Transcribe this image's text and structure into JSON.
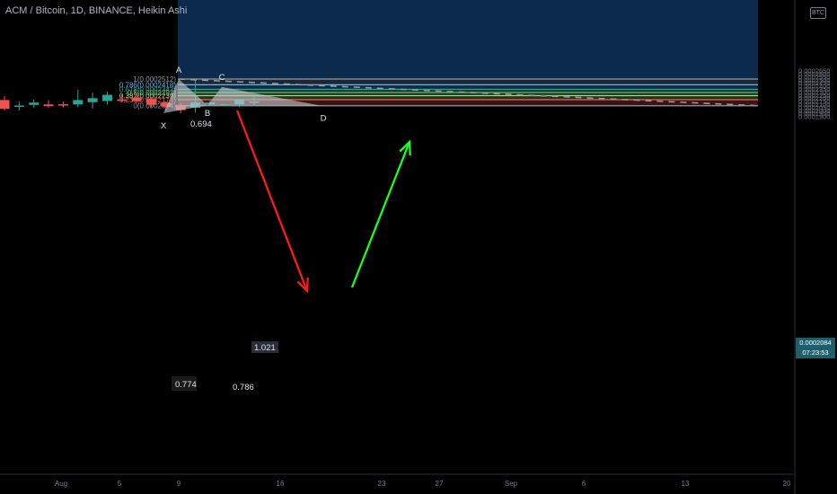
{
  "header": {
    "title": "ACM / Bitcoin, 1D, BINANCE, Heikin Ashi",
    "currency_badge": "BTC"
  },
  "price_tag": {
    "price": "0.0002084",
    "countdown": "07:23:53",
    "color": "#1e5f6e"
  },
  "colors": {
    "background": "#000000",
    "up_candle": "#26a69a",
    "down_candle": "#ef5350",
    "pattern_fill": "#c8ccd2",
    "down_arrow": "#ff1a1a",
    "up_arrow": "#1aff1a",
    "trend_line": "#9598a1"
  },
  "chart_data": {
    "type": "candlestick",
    "y_axis": {
      "ticks": [
        "0.0002650",
        "0.0002600",
        "0.0002550",
        "0.0002500",
        "0.0002450",
        "0.0002400",
        "0.0002350",
        "0.0002300",
        "0.0002250",
        "0.0002200",
        "0.0002150",
        "0.0002100",
        "0.0002050",
        "0.0002000",
        "0.0001950",
        "0.0001900"
      ],
      "ylim": [
        0.000187,
        0.0002665
      ]
    },
    "x_axis": {
      "ticks": [
        "Aug",
        "5",
        "9",
        "16",
        "23",
        "27",
        "Sep",
        "6",
        "13",
        "20"
      ]
    },
    "candles": [
      {
        "o": 0.0002168,
        "h": 0.0002232,
        "l": 0.0001998,
        "c": 0.0002023
      },
      {
        "o": 0.0002058,
        "h": 0.0002138,
        "l": 0.0001992,
        "c": 0.0002078
      },
      {
        "o": 0.0002088,
        "h": 0.0002175,
        "l": 0.0002038,
        "c": 0.0002126
      },
      {
        "o": 0.0002095,
        "h": 0.0002165,
        "l": 0.0002043,
        "c": 0.0002067
      },
      {
        "o": 0.0002098,
        "h": 0.0002142,
        "l": 0.0002045,
        "c": 0.0002095
      },
      {
        "o": 0.0002095,
        "h": 0.0002338,
        "l": 0.0002047,
        "c": 0.0002168
      },
      {
        "o": 0.0002133,
        "h": 0.0002288,
        "l": 0.0002028,
        "c": 0.0002198
      },
      {
        "o": 0.0002152,
        "h": 0.0002305,
        "l": 0.0002092,
        "c": 0.0002253
      },
      {
        "o": 0.0002177,
        "h": 0.0002262,
        "l": 0.0002142,
        "c": 0.0002172
      },
      {
        "o": 0.0002205,
        "h": 0.0002285,
        "l": 0.0002121,
        "c": 0.000215
      },
      {
        "o": 0.0002187,
        "h": 0.0002207,
        "l": 0.0002051,
        "c": 0.000209
      },
      {
        "o": 0.0002128,
        "h": 0.0002143,
        "l": 0.0001993,
        "c": 0.0002057
      },
      {
        "o": 0.0002087,
        "h": 0.0002118,
        "l": 0.000195,
        "c": 0.0002002
      },
      {
        "o": 0.0002042,
        "h": 0.0002506,
        "l": 0.0001962,
        "c": 0.0002127
      },
      {
        "o": 0.0002093,
        "h": 0.0002156,
        "l": 0.0002065,
        "c": 0.0002127
      },
      {
        "o": 0.0002088,
        "h": 0.0002102,
        "l": 0.0002075,
        "c": 0.0002095
      },
      {
        "o": 0.0002095,
        "h": 0.0002158,
        "l": 0.0002053,
        "c": 0.0002168
      },
      {
        "o": 0.000214,
        "h": 0.0002247,
        "l": 0.0002078,
        "c": 0.0002145
      }
    ],
    "fib_levels": [
      {
        "label": "1(0.0002512)",
        "value": 0.0002512,
        "color": "#9598a1",
        "fill": "#0f2a47"
      },
      {
        "label": "0.786(0.0002418)",
        "value": 0.0002418,
        "color": "#64b5f6",
        "fill": "#1d2733"
      },
      {
        "label": "0.618(0.0002343)",
        "value": 0.0002343,
        "color": "#26a69a",
        "fill": "#152c3e"
      },
      {
        "label": "0.5(0.0002291)",
        "value": 0.0002291,
        "color": "#66bb6a",
        "fill": "#103a2f"
      },
      {
        "label": "0.382(0.0002239)",
        "value": 0.0002239,
        "color": "#aed581",
        "fill": "#173821"
      },
      {
        "label": "0.236(0.0002174)",
        "value": 0.0002174,
        "color": "#ef5350",
        "fill": "#1e3418"
      },
      {
        "label": "0(0.0002074)",
        "value": 0.0002074,
        "color": "#9598a1",
        "fill": "#3d1414"
      }
    ],
    "harmonic_points": [
      {
        "label": "X",
        "value": 0.0001952
      },
      {
        "label": "A",
        "value": 0.0002512
      },
      {
        "label": "B",
        "value": 0.0002082
      },
      {
        "label": "C",
        "value": 0.0002383
      },
      {
        "label": "D",
        "value": 0.0002074
      }
    ],
    "ratios": [
      {
        "label": "0.694"
      },
      {
        "label": "0.774"
      },
      {
        "label": "1.021"
      },
      {
        "label": "0.786"
      }
    ],
    "trend_line": {
      "from": 0.0002512,
      "to": 0.0002074
    }
  }
}
